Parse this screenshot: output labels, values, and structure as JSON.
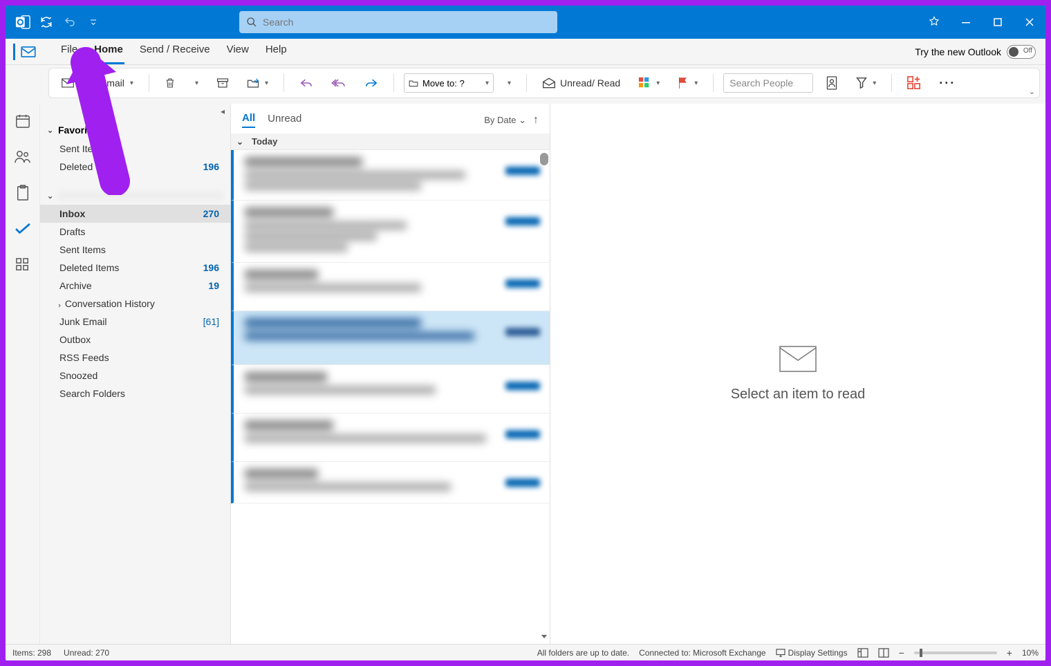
{
  "search_placeholder": "Search",
  "try_new_label": "Try the new Outlook",
  "toggle_state": "Off",
  "menu": {
    "file": "File",
    "home": "Home",
    "sendreceive": "Send / Receive",
    "view": "View",
    "help": "Help"
  },
  "ribbon": {
    "new_email": "New Email",
    "move_to": "Move to: ?",
    "unread_read": "Unread/ Read",
    "search_people": "Search People"
  },
  "folders": {
    "favorites": "Favorites",
    "fav_items": [
      {
        "name": "Sent Items",
        "count": ""
      },
      {
        "name": "Deleted Items",
        "count": "196"
      }
    ],
    "account_items": [
      {
        "name": "Inbox",
        "count": "270",
        "selected": true
      },
      {
        "name": "Drafts",
        "count": ""
      },
      {
        "name": "Sent Items",
        "count": ""
      },
      {
        "name": "Deleted Items",
        "count": "196"
      },
      {
        "name": "Archive",
        "count": "19"
      },
      {
        "name": "Conversation History",
        "count": "",
        "sub": true
      },
      {
        "name": "Junk Email",
        "count": "[61]",
        "bracket": true
      },
      {
        "name": "Outbox",
        "count": ""
      },
      {
        "name": "RSS Feeds",
        "count": ""
      },
      {
        "name": "Snoozed",
        "count": ""
      },
      {
        "name": "Search Folders",
        "count": ""
      }
    ]
  },
  "msglist": {
    "tab_all": "All",
    "tab_unread": "Unread",
    "sort_by": "By Date",
    "group_today": "Today"
  },
  "reading": {
    "placeholder": "Select an item to read"
  },
  "status": {
    "items": "Items: 298",
    "unread": "Unread: 270",
    "sync": "All folders are up to date.",
    "conn": "Connected to: Microsoft Exchange",
    "display": "Display Settings",
    "zoom": "10%"
  }
}
